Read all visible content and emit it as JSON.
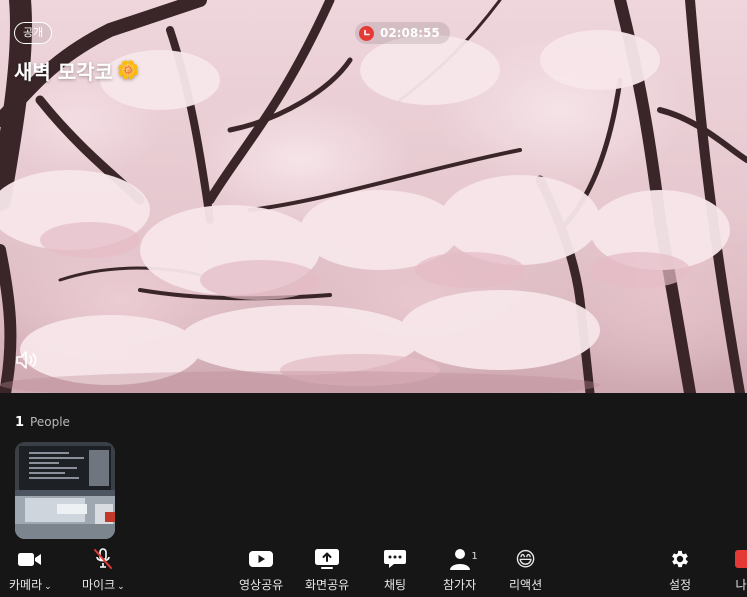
{
  "room": {
    "badge": "공개",
    "title": "새벽 모각코",
    "title_emoji": "🌼",
    "timer": "02:08:55"
  },
  "people": {
    "count": "1",
    "label": "People"
  },
  "toolbar": {
    "camera": "카메라",
    "mic": "마이크",
    "video_share": "영상공유",
    "screen_share": "화면공유",
    "chat": "채팅",
    "participants": "참가자",
    "participants_count": "1",
    "reaction": "리액션",
    "reaction_emoji": "😄",
    "settings": "설정",
    "leave": "나"
  },
  "colors": {
    "background": "#161616",
    "record": "#e53935",
    "leave": "#e53935"
  }
}
